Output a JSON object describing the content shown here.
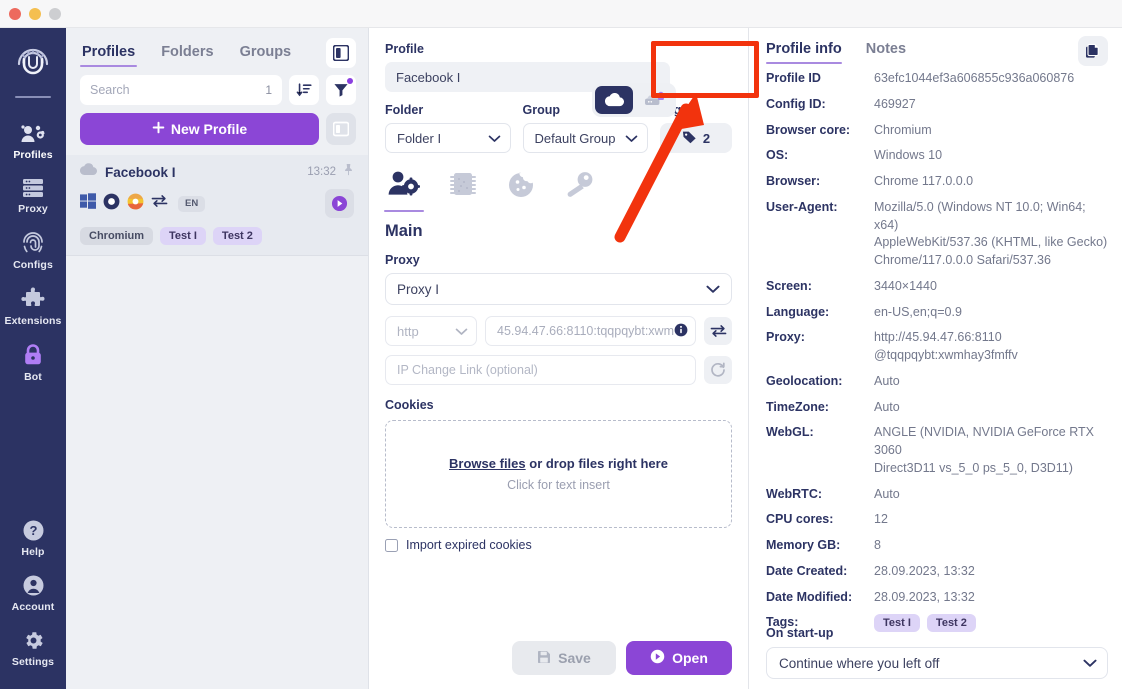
{
  "window": {
    "title": ""
  },
  "rail": {
    "logo_name": "fingerprint-logo",
    "items": [
      {
        "label": "Profiles",
        "icon": "profiles-icon",
        "active": true
      },
      {
        "label": "Proxy",
        "icon": "proxy-server-icon",
        "active": false
      },
      {
        "label": "Configs",
        "icon": "fingerprint-icon",
        "active": false
      },
      {
        "label": "Extensions",
        "icon": "puzzle-icon",
        "active": false
      },
      {
        "label": "Bot",
        "icon": "lock-icon",
        "active": false
      }
    ],
    "bottom_items": [
      {
        "label": "Help",
        "icon": "question-circle-icon"
      },
      {
        "label": "Account",
        "icon": "user-circle-icon"
      },
      {
        "label": "Settings",
        "icon": "gear-icon"
      }
    ]
  },
  "list_panel": {
    "tabs": [
      {
        "label": "Profiles",
        "active": true
      },
      {
        "label": "Folders",
        "active": false
      },
      {
        "label": "Groups",
        "active": false
      }
    ],
    "search": {
      "placeholder": "Search",
      "value": "",
      "count": "1"
    },
    "new_profile_label": "New Profile",
    "profile": {
      "name": "Facebook I",
      "time": "13:32",
      "lang": "EN",
      "tags": [
        {
          "label": "Chromium",
          "style": "grey"
        },
        {
          "label": "Test I",
          "style": "purple"
        },
        {
          "label": "Test 2",
          "style": "purple"
        }
      ]
    }
  },
  "editor": {
    "profile_label": "Profile",
    "profile_name": "Facebook I",
    "folder_label": "Folder",
    "folder_value": "Folder I",
    "group_label": "Group",
    "group_value": "Default Group",
    "tags_label": "Tags",
    "tags_count": "2",
    "storage_toggle": [
      {
        "icon": "cloud-icon",
        "active": true
      },
      {
        "icon": "local-storage-lock-icon",
        "active": false
      }
    ],
    "section_tabs": [
      {
        "icon": "user-settings-icon",
        "active": true
      },
      {
        "icon": "chip-icon",
        "active": false
      },
      {
        "icon": "cookie-icon",
        "active": false
      },
      {
        "icon": "key-icon",
        "active": false
      }
    ],
    "main_title": "Main",
    "proxy_label": "Proxy",
    "proxy_value": "Proxy I",
    "scheme_value": "http",
    "address_value": "45.94.47.66:8110:tqqpqybt:xwm",
    "ip_change_placeholder": "IP Change Link (optional)",
    "cookies_label": "Cookies",
    "dropzone_link": "Browse files",
    "dropzone_rest": " or drop files right here",
    "dropzone_sub": "Click for text insert",
    "import_expired_label": "Import expired cookies",
    "import_expired_checked": false,
    "save_label": "Save",
    "open_label": "Open"
  },
  "info_panel": {
    "tabs": [
      {
        "label": "Profile info",
        "active": true
      },
      {
        "label": "Notes",
        "active": false
      }
    ],
    "copy_icon": "copy-icon",
    "rows": [
      {
        "key": "Profile ID",
        "value": "63efc1044ef3a606855c936a060876"
      },
      {
        "key": "Config ID:",
        "value": "469927"
      },
      {
        "key": "Browser core:",
        "value": "Chromium"
      },
      {
        "key": "OS:",
        "value": "Windows 10"
      },
      {
        "key": "Browser:",
        "value": "Chrome 117.0.0.0"
      },
      {
        "key": "User-Agent:",
        "value": "Mozilla/5.0 (Windows NT 10.0; Win64; x64)\nAppleWebKit/537.36 (KHTML, like Gecko)\nChrome/117.0.0.0 Safari/537.36"
      },
      {
        "key": "Screen:",
        "value": "3440×1440"
      },
      {
        "key": "Language:",
        "value": "en-US,en;q=0.9"
      },
      {
        "key": "Proxy:",
        "value": "http://45.94.47.66:8110\n@tqqpqybt:xwmhay3fmffv"
      },
      {
        "key": "Geolocation:",
        "value": "Auto"
      },
      {
        "key": "TimeZone:",
        "value": "Auto"
      },
      {
        "key": "WebGL:",
        "value": "ANGLE (NVIDIA, NVIDIA GeForce RTX 3060\nDirect3D11 vs_5_0 ps_5_0, D3D11)"
      },
      {
        "key": "WebRTC:",
        "value": "Auto"
      },
      {
        "key": "CPU cores:",
        "value": "12"
      },
      {
        "key": "Memory GB:",
        "value": "8"
      },
      {
        "key": "Date Created:",
        "value": "28.09.2023, 13:32"
      },
      {
        "key": "Date Modified:",
        "value": "28.09.2023, 13:32"
      }
    ],
    "tags_key": "Tags:",
    "tags": [
      "Test I",
      "Test 2"
    ],
    "startup_label": "On start-up",
    "startup_value": "Continue where you left off"
  },
  "annotation": {
    "box_color": "#f2330d",
    "arrow_color": "#f2330d"
  },
  "colors": {
    "rail_bg": "#2c3363",
    "accent_purple": "#8b46d6",
    "tab_underline": "#a98ae0",
    "list_bg": "#eef0f4"
  }
}
